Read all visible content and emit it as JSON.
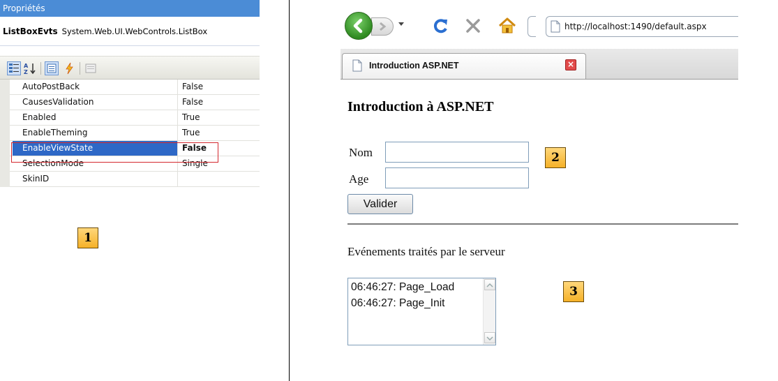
{
  "properties": {
    "title": "Propriétés",
    "object_name": "ListBoxEvts",
    "object_type": "System.Web.UI.WebControls.ListBox",
    "rows": [
      {
        "name": "AutoPostBack",
        "value": "False"
      },
      {
        "name": "CausesValidation",
        "value": "False"
      },
      {
        "name": "Enabled",
        "value": "True"
      },
      {
        "name": "EnableTheming",
        "value": "True"
      },
      {
        "name": "EnableViewState",
        "value": "False"
      },
      {
        "name": "SelectionMode",
        "value": "Single"
      },
      {
        "name": "SkinID",
        "value": ""
      }
    ],
    "marker": "1"
  },
  "browser": {
    "url": "http://localhost:1490/default.aspx",
    "tab_title": "Introduction ASP.NET",
    "page": {
      "heading": "Introduction à ASP.NET",
      "nom_label": "Nom",
      "age_label": "Age",
      "nom_value": "",
      "age_value": "",
      "submit_label": "Valider",
      "events_title": "Evénements traités par le serveur",
      "events": [
        "06:46:27: Page_Load",
        "06:46:27: Page_Init"
      ],
      "marker_form": "2",
      "marker_events": "3"
    }
  },
  "colors": {
    "titlebar": "#4b8cd6",
    "selection": "#2e68c6",
    "highlight_border": "#d3282e",
    "marker_fill": "#f5b128"
  }
}
